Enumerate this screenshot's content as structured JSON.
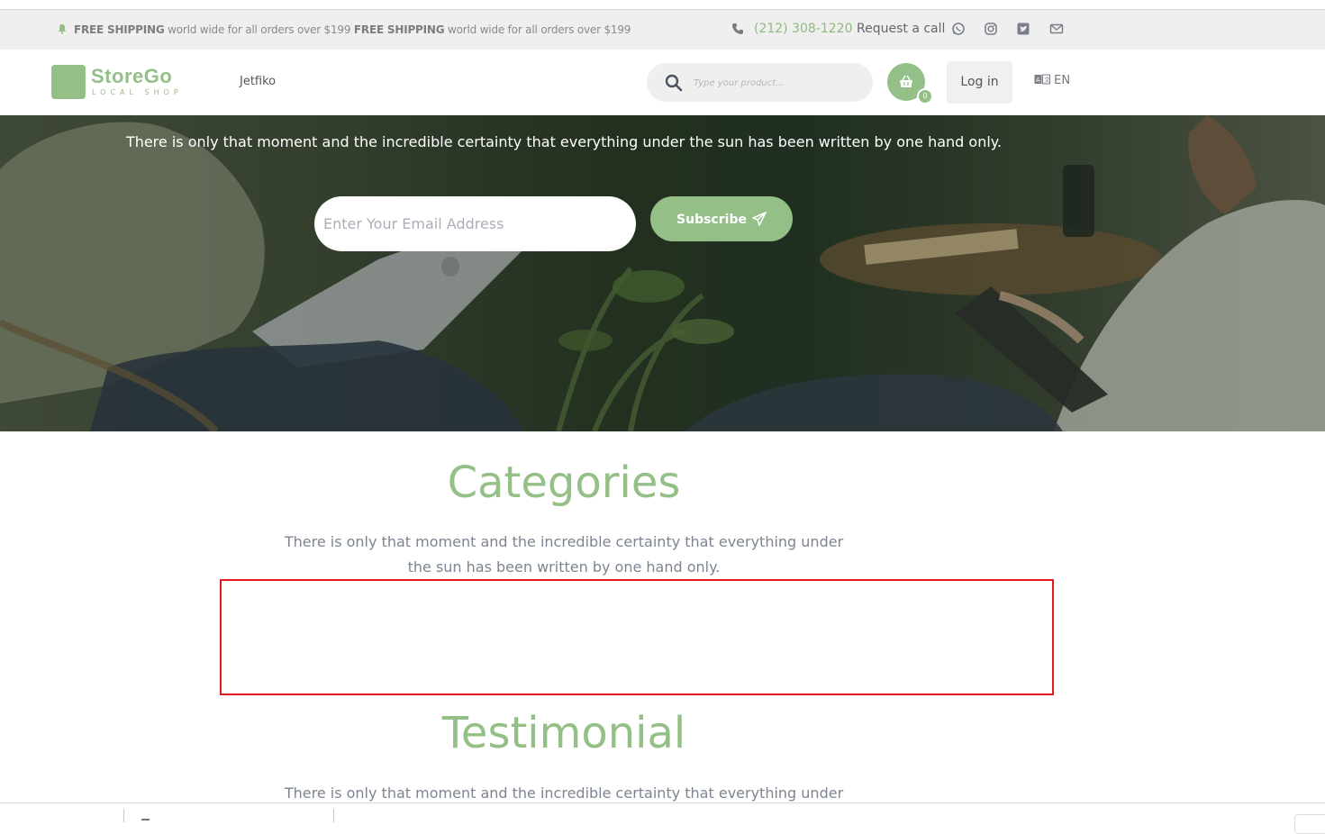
{
  "topbar": {
    "promo_bold_1": "FREE SHIPPING",
    "promo_text_1": " world wide for all orders over $199 ",
    "promo_bold_2": "FREE SHIPPING",
    "promo_text_2": " world wide for all orders over $199",
    "phone": "(212) 308-1220",
    "request_call": "Request a call",
    "social_icons": [
      "whatsapp-icon",
      "instagram-icon",
      "twitter-icon",
      "mail-icon"
    ]
  },
  "header": {
    "logo_name": "StoreGo",
    "logo_sub": "LOCAL SHOP",
    "nav_item": "Jetfiko",
    "search_placeholder": "Type your product...",
    "cart_count": "0",
    "login_label": "Log in",
    "language": "EN"
  },
  "hero": {
    "text": "There is only that moment and the incredible certainty that everything under the sun has been written by one hand only.",
    "email_placeholder": "Enter Your Email Address",
    "subscribe_label": "Subscribe"
  },
  "categories": {
    "title": "Categories",
    "text": "There is only that moment and the incredible certainty that everything under the sun has been written by one hand only."
  },
  "testimonial": {
    "title": "Testimonial",
    "text": "There is only that moment and the incredible certainty that everything under"
  },
  "colors": {
    "accent": "#94bf86",
    "highlight": "#e3191c",
    "muted_text": "#7c8591"
  }
}
